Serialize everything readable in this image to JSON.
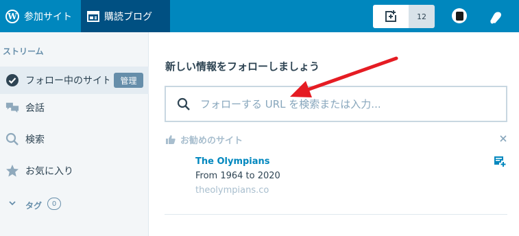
{
  "topbar": {
    "my_sites_label": "参加サイト",
    "reader_label": "購読ブログ",
    "write_count": "12"
  },
  "sidebar": {
    "header": "ストリーム",
    "items": [
      {
        "label": "フォロー中のサイト",
        "badge": "管理"
      },
      {
        "label": "会話"
      },
      {
        "label": "検索"
      },
      {
        "label": "お気に入り"
      }
    ],
    "tags_label": "タグ",
    "tags_count": "0"
  },
  "main": {
    "title": "新しい情報をフォローしましょう",
    "search_placeholder": "フォローする URL を検索または入力...",
    "recommended_header": "お勧めのサイト",
    "recommended": {
      "name": "The Olympians",
      "description": "From 1964 to 2020",
      "url": "theolympians.co"
    }
  },
  "colors": {
    "brand": "#0087be",
    "brand_dark": "#005082",
    "annotation_arrow": "#e51c23"
  }
}
